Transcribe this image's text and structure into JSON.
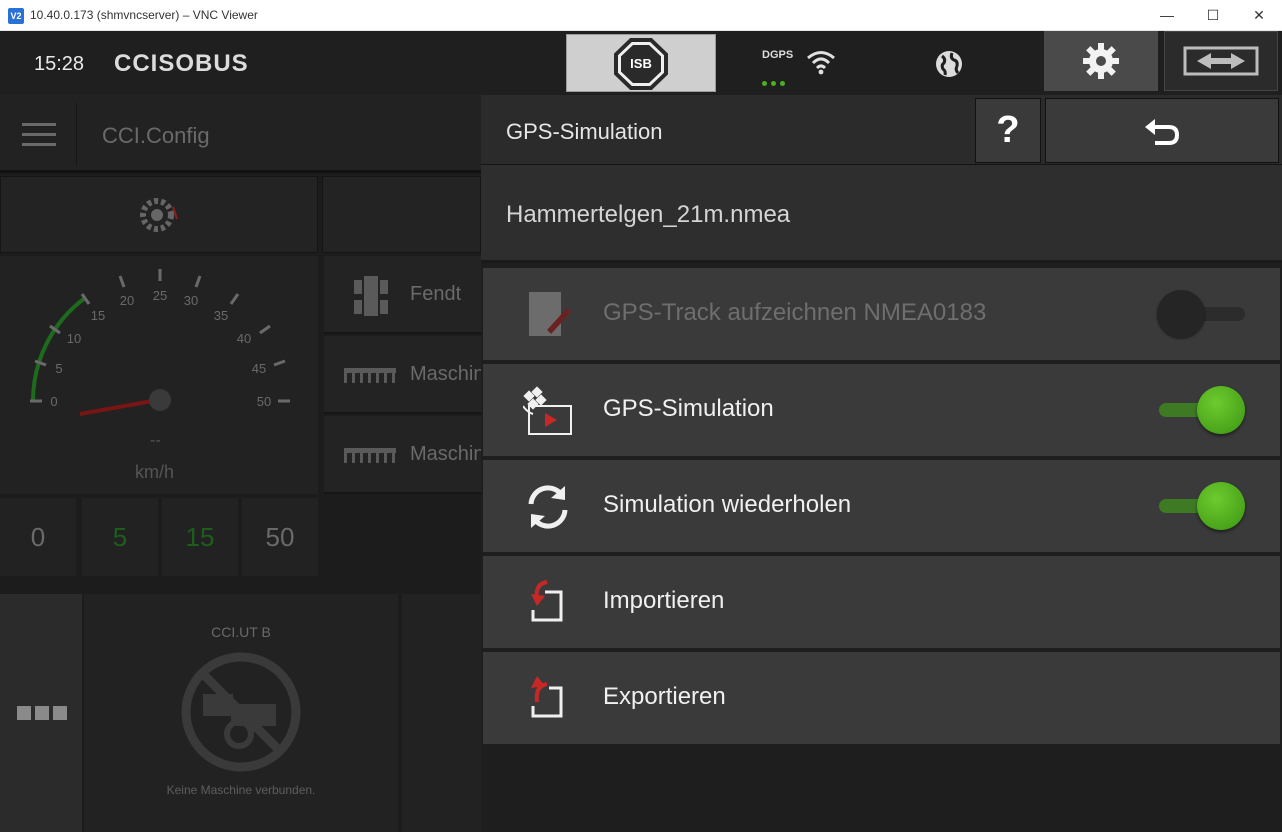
{
  "window": {
    "title": "10.40.0.173 (shmvncserver) – VNC Viewer",
    "app_icon": "V2",
    "controls": {
      "minimize": "—",
      "maximize": "☐",
      "close": "✕"
    }
  },
  "statusbar": {
    "time": "15:28",
    "logo": "CCISOBUS",
    "isb_label": "ISB",
    "dgps_label": "DGPS",
    "dgps_color": "#4caf22"
  },
  "background": {
    "app_title": "CCI.Config",
    "speedometer": {
      "ticks": [
        "0",
        "5",
        "10",
        "15",
        "20",
        "25",
        "30",
        "35",
        "40",
        "45",
        "50"
      ],
      "value": "--",
      "unit": "km/h"
    },
    "speed_presets": [
      "0",
      "5",
      "15",
      "50"
    ],
    "list": [
      "Fendt",
      "Maschine",
      "Maschine"
    ],
    "ut": {
      "title": "CCI.UT B",
      "message": "Keine Maschine verbunden."
    }
  },
  "panel": {
    "title": "GPS-Simulation",
    "help_label": "?",
    "filename": "Hammertelgen_21m.nmea",
    "rows": [
      {
        "label": "GPS-Track aufzeichnen NMEA0183",
        "enabled": false,
        "toggle": "off"
      },
      {
        "label": "GPS-Simulation",
        "enabled": true,
        "toggle": "on"
      },
      {
        "label": "Simulation wiederholen",
        "enabled": true,
        "toggle": "on"
      },
      {
        "label": "Importieren",
        "enabled": true
      },
      {
        "label": "Exportieren",
        "enabled": true
      }
    ],
    "accent_green": "#4caf22",
    "accent_red": "#c62828"
  }
}
